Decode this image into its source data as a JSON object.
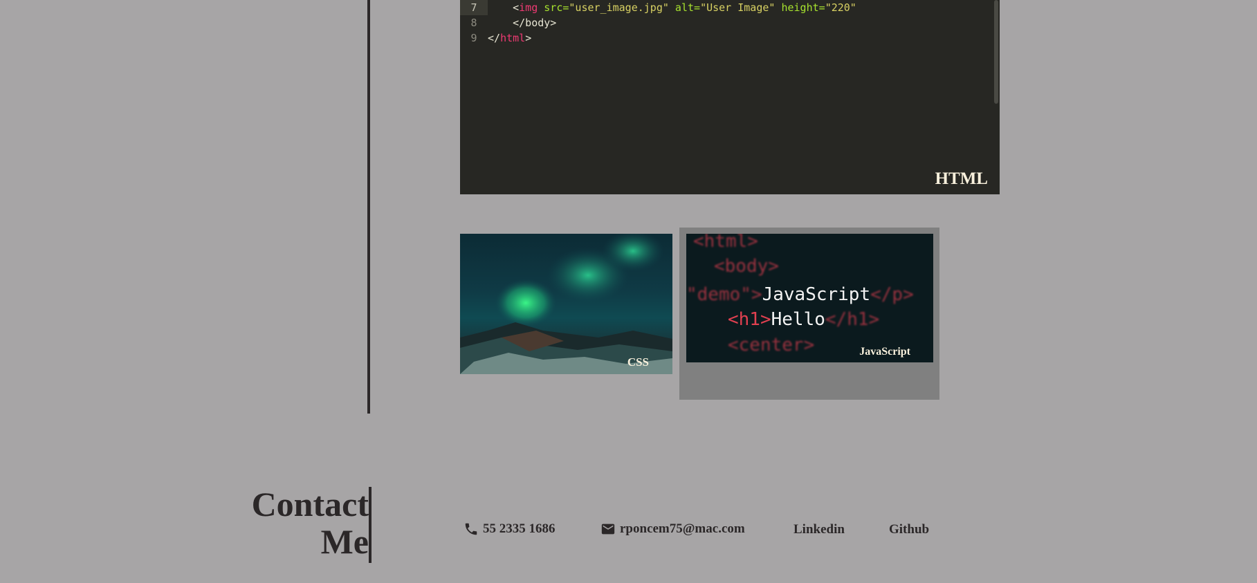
{
  "projects": {
    "html": {
      "label": "HTML",
      "code_lines": [
        {
          "num": "7",
          "indent": "    ",
          "open": "<",
          "tag": "img",
          "rest_attr1": " src=",
          "val1": "\"user_image.jpg\"",
          "rest_attr2": " alt=",
          "val2": "\"User Image\"",
          "rest_attr3": " height=",
          "val3": "\"220\""
        },
        {
          "num": "8",
          "text": "    </body>"
        },
        {
          "num": "9",
          "open": "</",
          "tag": "html",
          "close": ">"
        }
      ]
    },
    "css": {
      "label": "CSS"
    },
    "javascript": {
      "label": "JavaScript",
      "code": {
        "l1": "<html>",
        "l2": "<body>",
        "l3_pre": "\"demo\">",
        "l3_main": "JavaScript",
        "l3_post": "</p>",
        "l4_open": "<h1>",
        "l4_main": "Hello",
        "l4_post": "</h1>",
        "l5": "<center>"
      }
    }
  },
  "contact": {
    "title_line1": "Contact",
    "title_line2": "Me",
    "phone": "55 2335 1686",
    "email": "rponcem75@mac.com",
    "linkedin": "Linkedin",
    "github": "Github"
  },
  "icons": {
    "phone": "phone-icon",
    "email": "envelope-icon"
  },
  "colors": {
    "background": "#a7a5a6",
    "text": "#2b2728",
    "editor_bg": "#272723"
  }
}
